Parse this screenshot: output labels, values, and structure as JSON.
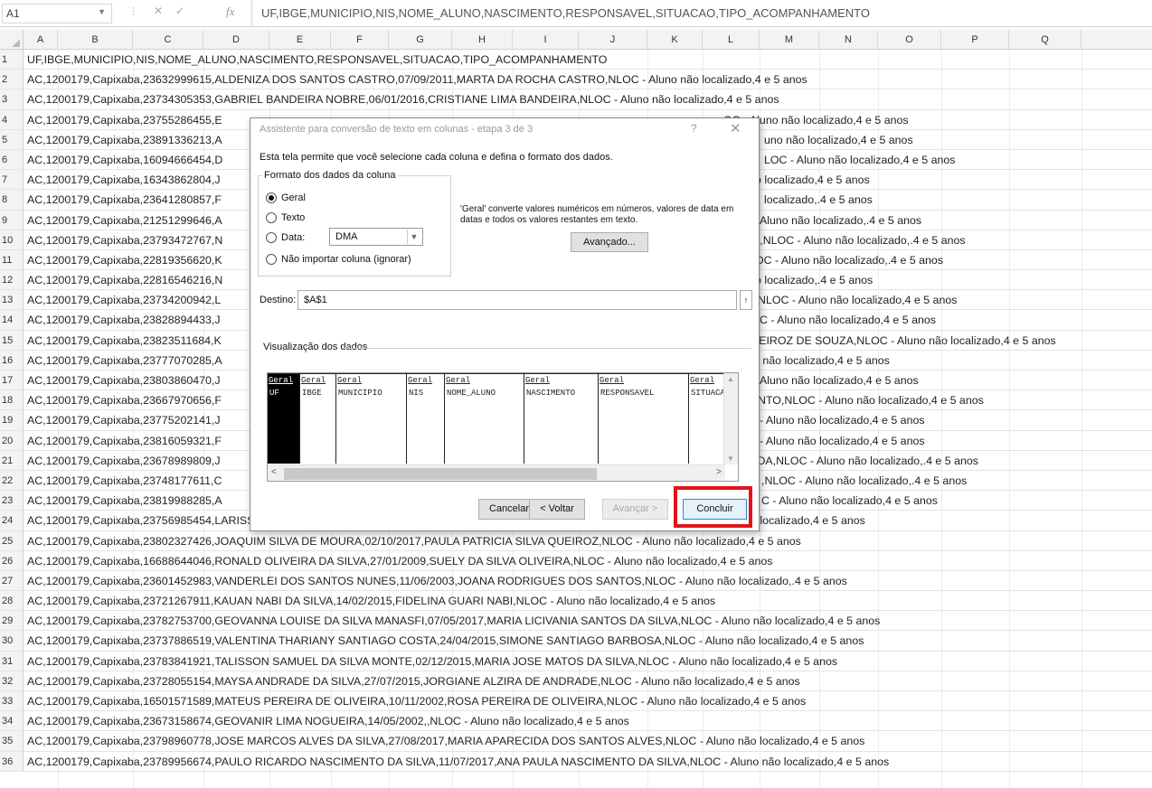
{
  "formula_bar": {
    "name_box": "A1",
    "fx": "fx",
    "content": "UF,IBGE,MUNICIPIO,NIS,NOME_ALUNO,NASCIMENTO,RESPONSAVEL,SITUACAO,TIPO_ACOMPANHAMENTO"
  },
  "columns": [
    "A",
    "B",
    "C",
    "D",
    "E",
    "F",
    "G",
    "H",
    "I",
    "J",
    "K",
    "L",
    "M",
    "N",
    "O",
    "P",
    "Q"
  ],
  "rows": [
    {
      "n": "1",
      "text": "UF,IBGE,MUNICIPIO,NIS,NOME_ALUNO,NASCIMENTO,RESPONSAVEL,SITUACAO,TIPO_ACOMPANHAMENTO",
      "right": ""
    },
    {
      "n": "2",
      "text": "AC,1200179,Capixaba,23632999615,ALDENIZA DOS SANTOS CASTRO,07/09/2011,MARTA DA ROCHA CASTRO,NLOC - Aluno não localizado,4 e 5 anos",
      "right": ""
    },
    {
      "n": "3",
      "text": "AC,1200179,Capixaba,23734305353,GABRIEL BANDEIRA NOBRE,06/01/2016,CRISTIANE LIMA BANDEIRA,NLOC - Aluno não localizado,4 e 5 anos",
      "right": ""
    },
    {
      "n": "4",
      "text": "AC,1200179,Capixaba,23755286455,E",
      "right": "OC - Aluno não localizado,4 e 5 anos"
    },
    {
      "n": "5",
      "text": "AC,1200179,Capixaba,23891336213,A",
      "right": "uno não localizado,4 e 5 anos"
    },
    {
      "n": "6",
      "text": "AC,1200179,Capixaba,16094666454,D",
      "right": "LOC - Aluno não localizado,4 e 5 anos"
    },
    {
      "n": "7",
      "text": "AC,1200179,Capixaba,16343862804,J",
      "right": "o localizado,4 e 5 anos"
    },
    {
      "n": "8",
      "text": "AC,1200179,Capixaba,23641280857,F",
      "right": "localizado,.4 e 5 anos"
    },
    {
      "n": "9",
      "text": "AC,1200179,Capixaba,21251299646,A",
      "right": "Aluno não localizado,.4 e 5 anos"
    },
    {
      "n": "10",
      "text": "AC,1200179,Capixaba,23793472767,N",
      "right": "A,NLOC - Aluno não localizado,.4 e 5 anos"
    },
    {
      "n": "11",
      "text": "AC,1200179,Capixaba,22819356620,K",
      "right": "OC - Aluno não localizado,.4 e 5 anos"
    },
    {
      "n": "12",
      "text": "AC,1200179,Capixaba,22816546216,N",
      "right": "o localizado,.4 e 5 anos"
    },
    {
      "n": "13",
      "text": "AC,1200179,Capixaba,23734200942,L",
      "right": "NLOC - Aluno não localizado,4 e 5 anos"
    },
    {
      "n": "14",
      "text": "AC,1200179,Capixaba,23828894433,J",
      "right": "C - Aluno não localizado,4 e 5 anos"
    },
    {
      "n": "15",
      "text": "AC,1200179,Capixaba,23823511684,K",
      "right": "JEIROZ DE SOUZA,NLOC - Aluno não localizado,4 e 5 anos"
    },
    {
      "n": "16",
      "text": "AC,1200179,Capixaba,23777070285,A",
      "right": "o não localizado,4 e 5 anos"
    },
    {
      "n": "17",
      "text": "AC,1200179,Capixaba,23803860470,J",
      "right": "Aluno não localizado,4 e 5 anos"
    },
    {
      "n": "18",
      "text": "AC,1200179,Capixaba,23667970656,F",
      "right": "NTO,NLOC - Aluno não localizado,4 e 5 anos"
    },
    {
      "n": "19",
      "text": "AC,1200179,Capixaba,23775202141,J",
      "right": "- Aluno não localizado,4 e 5 anos"
    },
    {
      "n": "20",
      "text": "AC,1200179,Capixaba,23816059321,F",
      "right": "- Aluno não localizado,4 e 5 anos"
    },
    {
      "n": "21",
      "text": "AC,1200179,Capixaba,23678989809,J",
      "right": "IDA,NLOC - Aluno não localizado,.4 e 5 anos"
    },
    {
      "n": "22",
      "text": "AC,1200179,Capixaba,23748177611,C",
      "right": ",NLOC - Aluno não localizado,.4 e 5 anos"
    },
    {
      "n": "23",
      "text": "AC,1200179,Capixaba,23819988285,A",
      "right": "C - Aluno não localizado,4 e 5 anos"
    },
    {
      "n": "24",
      "text": "AC,1200179,Capixaba,23756985454,LARISSA MANOELA COSTA DA SILVA,13/04/2016,MARIA ALBERTINA COSTA DA SILVA,NLOC - Aluno não localizado,4 e 5 anos",
      "right": ""
    },
    {
      "n": "25",
      "text": "AC,1200179,Capixaba,23802327426,JOAQUIM SILVA DE MOURA,02/10/2017,PAULA PATRICIA SILVA QUEIROZ,NLOC - Aluno não localizado,4 e 5 anos",
      "right": ""
    },
    {
      "n": "26",
      "text": "AC,1200179,Capixaba,16688644046,RONALD OLIVEIRA DA SILVA,27/01/2009,SUELY DA SILVA OLIVEIRA,NLOC - Aluno não localizado,4 e 5 anos",
      "right": ""
    },
    {
      "n": "27",
      "text": "AC,1200179,Capixaba,23601452983,VANDERLEI DOS SANTOS NUNES,11/06/2003,JOANA RODRIGUES DOS SANTOS,NLOC - Aluno não localizado,.4 e 5 anos",
      "right": ""
    },
    {
      "n": "28",
      "text": "AC,1200179,Capixaba,23721267911,KAUAN NABI DA SILVA,14/02/2015,FIDELINA GUARI NABI,NLOC - Aluno não localizado,4 e 5 anos",
      "right": ""
    },
    {
      "n": "29",
      "text": "AC,1200179,Capixaba,23782753700,GEOVANNA LOUISE DA SILVA MANASFI,07/05/2017,MARIA LICIVANIA SANTOS DA SILVA,NLOC - Aluno não localizado,4 e 5 anos",
      "right": ""
    },
    {
      "n": "30",
      "text": "AC,1200179,Capixaba,23737886519,VALENTINA THARIANY SANTIAGO COSTA,24/04/2015,SIMONE SANTIAGO BARBOSA,NLOC - Aluno não localizado,4 e 5 anos",
      "right": ""
    },
    {
      "n": "31",
      "text": "AC,1200179,Capixaba,23783841921,TALISSON SAMUEL DA SILVA MONTE,02/12/2015,MARIA JOSE MATOS DA SILVA,NLOC - Aluno não localizado,4 e 5 anos",
      "right": ""
    },
    {
      "n": "32",
      "text": "AC,1200179,Capixaba,23728055154,MAYSA ANDRADE DA SILVA,27/07/2015,JORGIANE ALZIRA DE ANDRADE,NLOC - Aluno não localizado,4 e 5 anos",
      "right": ""
    },
    {
      "n": "33",
      "text": "AC,1200179,Capixaba,16501571589,MATEUS PEREIRA DE OLIVEIRA,10/11/2002,ROSA PEREIRA DE OLIVEIRA,NLOC - Aluno não localizado,4 e 5 anos",
      "right": ""
    },
    {
      "n": "34",
      "text": "AC,1200179,Capixaba,23673158674,GEOVANIR LIMA NOGUEIRA,14/05/2002,,NLOC - Aluno não localizado,4 e 5 anos",
      "right": ""
    },
    {
      "n": "35",
      "text": "AC,1200179,Capixaba,23798960778,JOSE MARCOS ALVES DA SILVA,27/08/2017,MARIA APARECIDA DOS SANTOS ALVES,NLOC - Aluno não localizado,4 e 5 anos",
      "right": ""
    },
    {
      "n": "36",
      "text": "AC,1200179,Capixaba,23789956674,PAULO RICARDO NASCIMENTO DA SILVA,11/07/2017,ANA PAULA NASCIMENTO DA SILVA,NLOC - Aluno não localizado,4 e 5 anos",
      "right": ""
    }
  ],
  "dialog": {
    "title": "Assistente para conversão de texto em colunas - etapa 3 de 3",
    "help": "?",
    "close": "✕",
    "description": "Esta tela permite que você selecione cada coluna e defina o formato dos dados.",
    "format_group": "Formato dos dados da coluna",
    "opt_general": "Geral",
    "opt_text": "Texto",
    "opt_date": "Data:",
    "date_value": "DMA",
    "opt_skip": "Não importar coluna (ignorar)",
    "info": "'Geral' converte valores numéricos em números, valores de data em datas e todos os valores restantes em texto.",
    "advanced": "Avançado...",
    "dest_label": "Destino:",
    "dest_value": "$A$1",
    "preview_label": "Visualização dos dados",
    "preview_cols": [
      {
        "h": "Geral",
        "d": "UF"
      },
      {
        "h": "Geral",
        "d": "IBGE"
      },
      {
        "h": "Geral",
        "d": "MUNICIPIO"
      },
      {
        "h": "Geral",
        "d": "NIS"
      },
      {
        "h": "Geral",
        "d": "NOME_ALUNO"
      },
      {
        "h": "Geral",
        "d": "NASCIMENTO"
      },
      {
        "h": "Geral",
        "d": "RESPONSAVEL"
      },
      {
        "h": "Geral",
        "d": "SITUACA"
      }
    ],
    "cancel": "Cancelar",
    "back": "< Voltar",
    "next": "Avançar >",
    "finish": "Concluir"
  }
}
